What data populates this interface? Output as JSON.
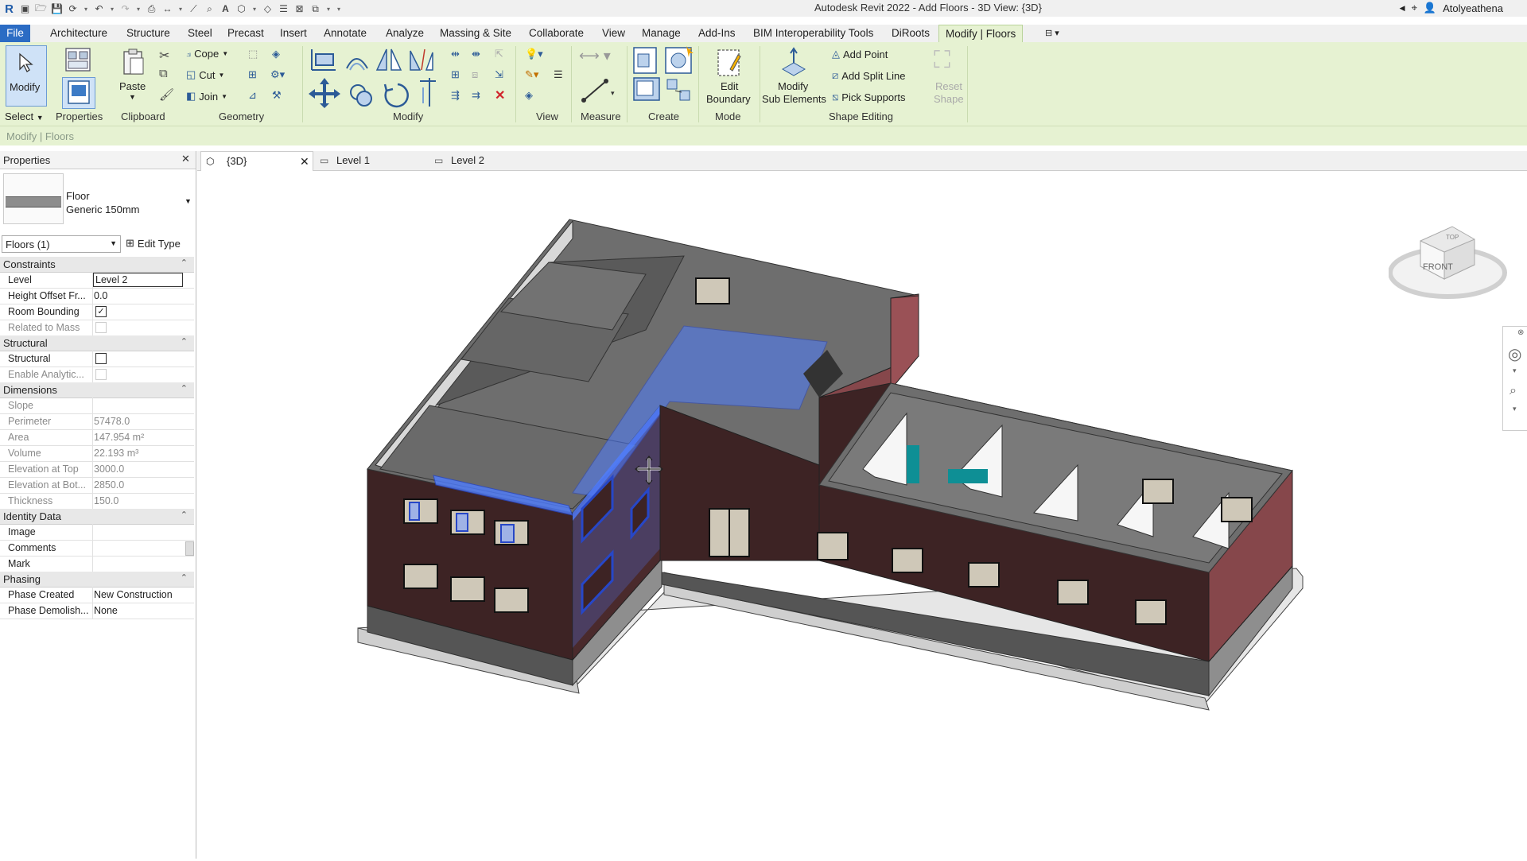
{
  "title_bar": {
    "app_title": "Autodesk Revit 2022 - Add Floors - 3D View: {3D}",
    "user": "Atolyeathena"
  },
  "menu_tabs": [
    {
      "label": "File"
    },
    {
      "label": "Architecture"
    },
    {
      "label": "Structure"
    },
    {
      "label": "Steel"
    },
    {
      "label": "Precast"
    },
    {
      "label": "Insert"
    },
    {
      "label": "Annotate"
    },
    {
      "label": "Analyze"
    },
    {
      "label": "Massing & Site"
    },
    {
      "label": "Collaborate"
    },
    {
      "label": "View"
    },
    {
      "label": "Manage"
    },
    {
      "label": "Add-Ins"
    },
    {
      "label": "BIM Interoperability Tools"
    },
    {
      "label": "DiRoots"
    },
    {
      "label": "Modify | Floors"
    }
  ],
  "ribbon": {
    "select": {
      "modify": "Modify",
      "panel": "Select"
    },
    "properties": {
      "panel": "Properties"
    },
    "clipboard": {
      "paste": "Paste",
      "panel": "Clipboard"
    },
    "geometry": {
      "cope": "Cope",
      "cut": "Cut",
      "join": "Join",
      "panel": "Geometry"
    },
    "modify": {
      "panel": "Modify"
    },
    "view": {
      "panel": "View"
    },
    "measure": {
      "panel": "Measure"
    },
    "create": {
      "panel": "Create"
    },
    "mode": {
      "edit_boundary_1": "Edit",
      "edit_boundary_2": "Boundary",
      "panel": "Mode"
    },
    "shape_editing": {
      "modify_sub_1": "Modify",
      "modify_sub_2": "Sub Elements",
      "add_point": "Add Point",
      "add_split_line": "Add Split Line",
      "pick_supports": "Pick Supports",
      "reset_shape_1": "Reset",
      "reset_shape_2": "Shape",
      "panel": "Shape Editing"
    }
  },
  "context_label": "Modify | Floors",
  "properties": {
    "header": "Properties",
    "type_family": "Floor",
    "type_name": "Generic 150mm",
    "selector": "Floors (1)",
    "edit_type": "Edit Type",
    "groups": {
      "constraints": "Constraints",
      "structural": "Structural",
      "dimensions": "Dimensions",
      "identity": "Identity Data",
      "phasing": "Phasing"
    },
    "rows": {
      "level": {
        "name": "Level",
        "value": "Level 2"
      },
      "height_offset": {
        "name": "Height Offset Fr...",
        "value": "0.0"
      },
      "room_bounding": {
        "name": "Room Bounding",
        "value": "✓"
      },
      "related_mass": {
        "name": "Related to Mass"
      },
      "structural": {
        "name": "Structural"
      },
      "enable_analytic": {
        "name": "Enable Analytic..."
      },
      "slope": {
        "name": "Slope"
      },
      "perimeter": {
        "name": "Perimeter",
        "value": "57478.0"
      },
      "area": {
        "name": "Area",
        "value": "147.954 m²"
      },
      "volume": {
        "name": "Volume",
        "value": "22.193 m³"
      },
      "elev_top": {
        "name": "Elevation at Top",
        "value": "3000.0"
      },
      "elev_bottom": {
        "name": "Elevation at Bot...",
        "value": "2850.0"
      },
      "thickness": {
        "name": "Thickness",
        "value": "150.0"
      },
      "image": {
        "name": "Image"
      },
      "comments": {
        "name": "Comments"
      },
      "mark": {
        "name": "Mark"
      },
      "phase_created": {
        "name": "Phase Created",
        "value": "New Construction"
      },
      "phase_demolished": {
        "name": "Phase Demolish...",
        "value": "None"
      }
    }
  },
  "view_tabs": [
    {
      "label": "{3D}"
    },
    {
      "label": "Level 1"
    },
    {
      "label": "Level 2"
    }
  ],
  "viewcube": {
    "top": "TOP",
    "front": "FRONT"
  },
  "colors": {
    "ribbon_bg": "#e6f2d2",
    "file_tab": "#2b6cc4",
    "wall_brick": "#4a2a2c",
    "selection_blue": "#4f7dff"
  }
}
